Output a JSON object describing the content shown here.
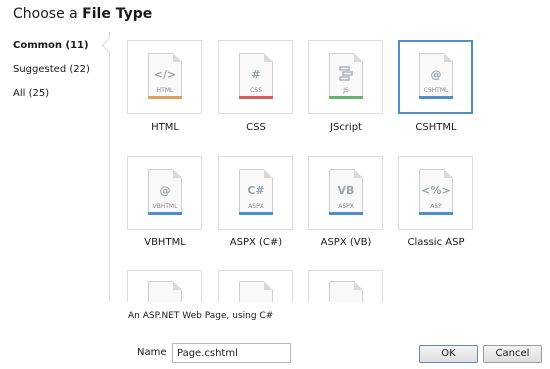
{
  "dialog": {
    "title_prefix": "Choose a ",
    "title_bold": "File Type"
  },
  "categories": [
    {
      "label": "Common (11)",
      "selected": true
    },
    {
      "label": "Suggested (22)",
      "selected": false
    },
    {
      "label": "All (25)",
      "selected": false
    }
  ],
  "file_types": [
    {
      "label": "HTML",
      "ext": "HTML",
      "glyph": "</>",
      "strip_color": "#e0a060",
      "selected": false
    },
    {
      "label": "CSS",
      "ext": "CSS",
      "glyph": "#",
      "strip_color": "#d85c5c",
      "selected": false
    },
    {
      "label": "JScript",
      "ext": "JS",
      "glyph": "",
      "strip_color": "#66b370",
      "selected": false
    },
    {
      "label": "CSHTML",
      "ext": "CSHTML",
      "glyph": "@",
      "strip_color": "#4f8ec9",
      "selected": true
    },
    {
      "label": "VBHTML",
      "ext": "VBHTML",
      "glyph": "@",
      "strip_color": "#4f8ec9",
      "selected": false
    },
    {
      "label": "ASPX (C#)",
      "ext": "ASPX",
      "glyph": "C#",
      "strip_color": "#4f8ec9",
      "selected": false
    },
    {
      "label": "ASPX (VB)",
      "ext": "ASPX",
      "glyph": "VB",
      "strip_color": "#4f8ec9",
      "selected": false
    },
    {
      "label": "Classic ASP",
      "ext": "ASP",
      "glyph": "<%>",
      "strip_color": "#4f8ec9",
      "selected": false
    }
  ],
  "description": "An ASP.NET Web Page, using C#",
  "name_field": {
    "label": "Name",
    "value": "Page.cshtml"
  },
  "buttons": {
    "ok": "OK",
    "cancel": "Cancel"
  }
}
